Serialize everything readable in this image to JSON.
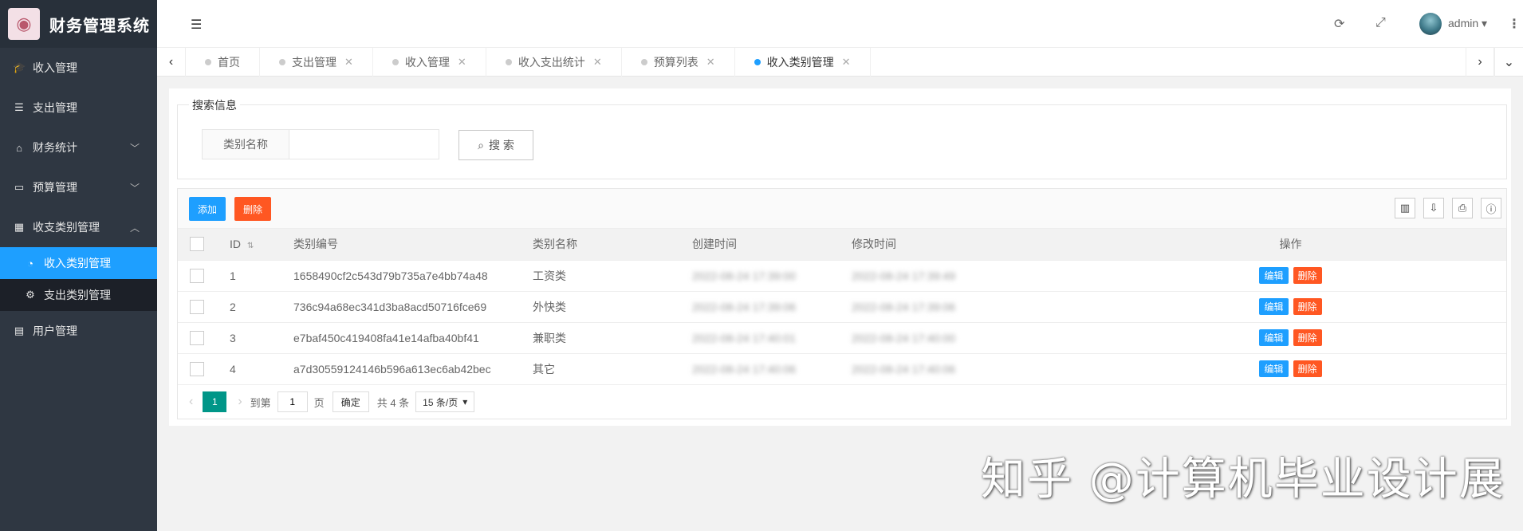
{
  "app": {
    "title": "财务管理系统",
    "logo_icon": "eye-logo"
  },
  "sidebar": {
    "items": [
      {
        "label": "收入管理",
        "icon": "graduation-cap-icon"
      },
      {
        "label": "支出管理",
        "icon": "list-icon"
      },
      {
        "label": "财务统计",
        "icon": "home-icon",
        "arrow": "chevron-down"
      },
      {
        "label": "预算管理",
        "icon": "window-icon",
        "arrow": "chevron-down"
      },
      {
        "label": "收支类别管理",
        "icon": "calendar-icon",
        "arrow": "chevron-up"
      },
      {
        "label": "用户管理",
        "icon": "id-card-icon"
      }
    ],
    "sub_items": [
      {
        "label": "收入类别管理",
        "icon": "dashboard-icon",
        "active": true
      },
      {
        "label": "支出类别管理",
        "icon": "gears-icon"
      }
    ]
  },
  "header": {
    "user": "admin"
  },
  "tabs": [
    {
      "label": "首页"
    },
    {
      "label": "支出管理"
    },
    {
      "label": "收入管理"
    },
    {
      "label": "收入支出统计"
    },
    {
      "label": "预算列表"
    },
    {
      "label": "收入类别管理",
      "active": true
    }
  ],
  "search": {
    "legend": "搜索信息",
    "field_label": "类别名称",
    "field_value": "",
    "button": "搜 索"
  },
  "toolbar": {
    "add": "添加",
    "delete": "删除"
  },
  "table": {
    "headers": [
      "ID",
      "类别编号",
      "类别名称",
      "创建时间",
      "修改时间",
      "操作"
    ],
    "rows": [
      {
        "id": "1",
        "code": "1658490cf2c543d79b735a7e4bb74a48",
        "name": "工资类",
        "created": "2022-08-24 17:39:00",
        "modified": "2022-08-24 17:39:49"
      },
      {
        "id": "2",
        "code": "736c94a68ec341d3ba8acd50716fce69",
        "name": "外快类",
        "created": "2022-08-24 17:39:06",
        "modified": "2022-08-24 17:39:06"
      },
      {
        "id": "3",
        "code": "e7baf450c419408fa41e14afba40bf41",
        "name": "兼职类",
        "created": "2022-08-24 17:40:01",
        "modified": "2022-08-24 17:40:00"
      },
      {
        "id": "4",
        "code": "a7d30559124146b596a613ec6ab42bec",
        "name": "其它",
        "created": "2022-08-24 17:40:06",
        "modified": "2022-08-24 17:40:06"
      }
    ],
    "edit_label": "编辑",
    "delete_label": "删除"
  },
  "pager": {
    "current": "1",
    "goto": "到第",
    "page_input": "1",
    "page_unit": "页",
    "confirm": "确定",
    "total": "共 4 条",
    "per_page": "15 条/页"
  },
  "watermark": "知乎 @计算机毕业设计展",
  "colors": {
    "sidebar": "#2f3742",
    "active": "#1e9fff",
    "danger": "#ff5722",
    "pager": "#009688"
  }
}
